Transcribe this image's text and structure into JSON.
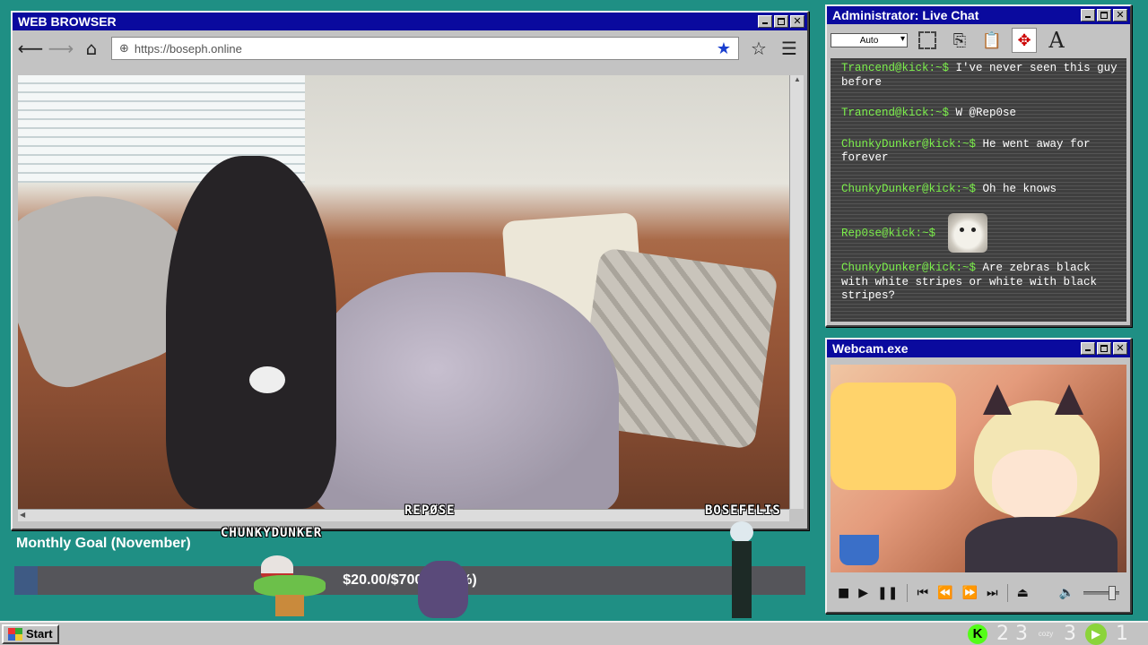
{
  "browser": {
    "title": "WEB BROWSER",
    "url": "https://boseph.online",
    "controls": {
      "minimize": "",
      "maximize": "",
      "close": "✕"
    }
  },
  "chat": {
    "title": "Administrator: Live Chat",
    "select_value": "Auto",
    "messages": [
      {
        "user": "Trancend@kick:~$",
        "text": "I've never seen this guy before"
      },
      {
        "user": "Trancend@kick:~$",
        "text": "W @Rep0se"
      },
      {
        "user": "ChunkyDunker@kick:~$",
        "text": "He went away for forever"
      },
      {
        "user": "ChunkyDunker@kick:~$",
        "text": "Oh he knows"
      },
      {
        "user": "Rep0se@kick:~$",
        "text": ""
      },
      {
        "user": "ChunkyDunker@kick:~$",
        "text": "Are zebras black with white stripes or white with black stripes?"
      }
    ]
  },
  "webcam": {
    "title": "Webcam.exe",
    "icons": [
      "stop-icon",
      "play-icon",
      "pause-icon",
      "skip-start-icon",
      "rewind-icon",
      "fast-forward-icon",
      "skip-end-icon",
      "eject-icon",
      "volume-icon"
    ]
  },
  "goal": {
    "title": "Monthly Goal (November)",
    "amount_text": "$20.00/$700.00 (3%)",
    "progress": 0.03
  },
  "players": {
    "chunky": "CHUNKYDUNKER",
    "repose": "REPØSE",
    "bose": "BOSEFELIS"
  },
  "taskbar": {
    "start_label": "Start",
    "tray": {
      "kick_letter": "K",
      "kick_count": "2 3",
      "cozy": "cozy",
      "cozy_count": "3",
      "play_count": "1"
    }
  },
  "colors": {
    "accent": "#0a0a9e",
    "desktop": "#1f8f84",
    "chat_prompt": "#7cf04b",
    "goal_fill": "#3e5a84"
  }
}
